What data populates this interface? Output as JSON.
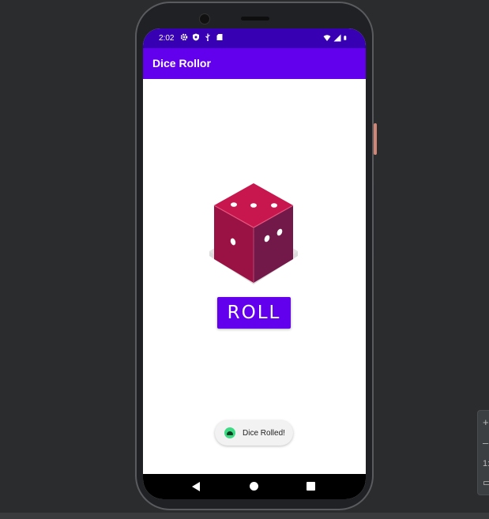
{
  "status_bar": {
    "time": "2:02",
    "left_icons": [
      "settings-icon",
      "shield-icon",
      "usb-icon",
      "sd-card-icon"
    ],
    "right_icons": [
      "wifi-icon",
      "signal-icon",
      "battery-icon"
    ]
  },
  "app_bar": {
    "title": "Dice Rollor"
  },
  "main": {
    "dice_image": "dice-icon",
    "roll_button_label": "ROLL"
  },
  "toast": {
    "message": "Dice Rolled!",
    "icon": "android-icon"
  },
  "nav_bar": {
    "buttons": [
      "back-icon",
      "home-icon",
      "recents-icon"
    ]
  },
  "side_panel": {
    "glyphs": [
      "+",
      "–",
      "1:",
      "▭"
    ]
  },
  "colors": {
    "status_bar": "#3700b3",
    "app_bar": "#6200ee",
    "button": "#6200ee",
    "dice_top": "#c2185b",
    "dice_side": "#8e1548",
    "toast_icon": "#3ddc84"
  }
}
